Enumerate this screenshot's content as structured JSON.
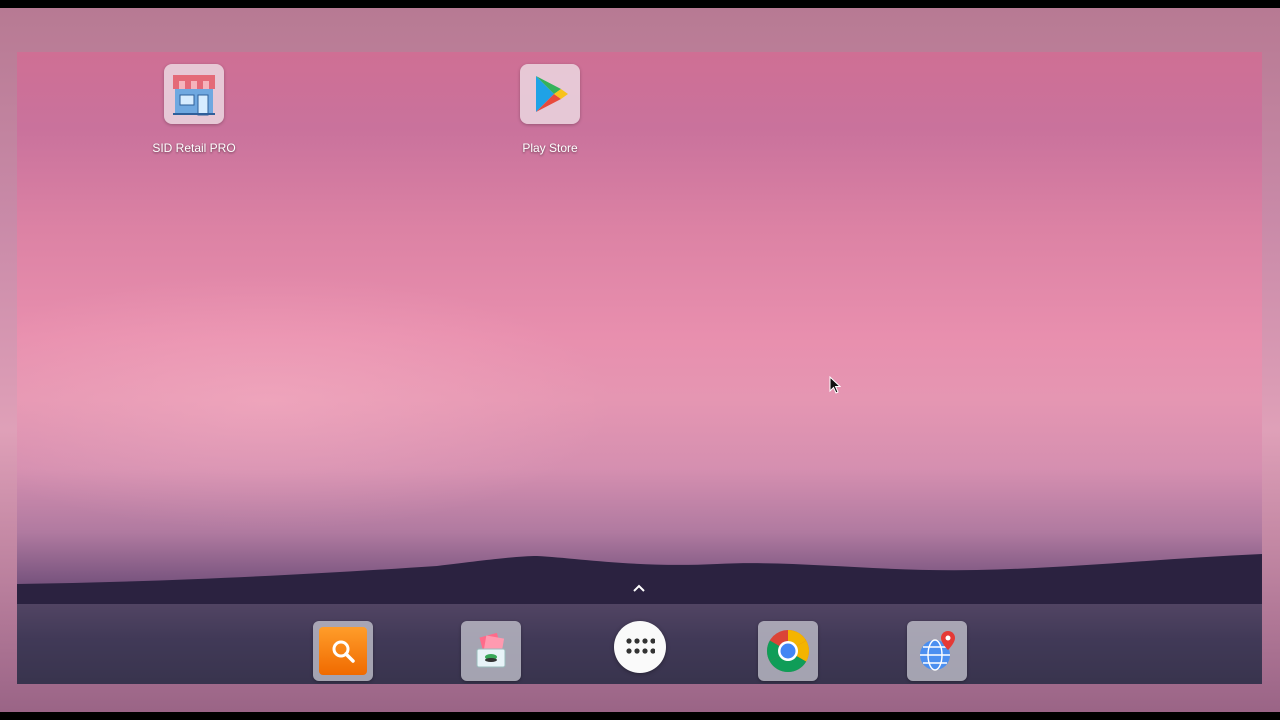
{
  "desktop": {
    "icons": [
      {
        "label": "SID Retail PRO",
        "icon": "store-icon"
      },
      {
        "label": "Play Store",
        "icon": "play-store-icon"
      }
    ]
  },
  "dock": {
    "items": [
      {
        "icon": "search-icon"
      },
      {
        "icon": "gallery-icon"
      },
      {
        "icon": "app-drawer-icon"
      },
      {
        "icon": "chrome-icon"
      },
      {
        "icon": "maps-globe-icon"
      }
    ]
  },
  "colors": {
    "wallpaper_top": "#cf6f94",
    "wallpaper_mid": "#e88fae",
    "wallpaper_bottom": "#2a2040",
    "dock_bg": "#46465a"
  }
}
